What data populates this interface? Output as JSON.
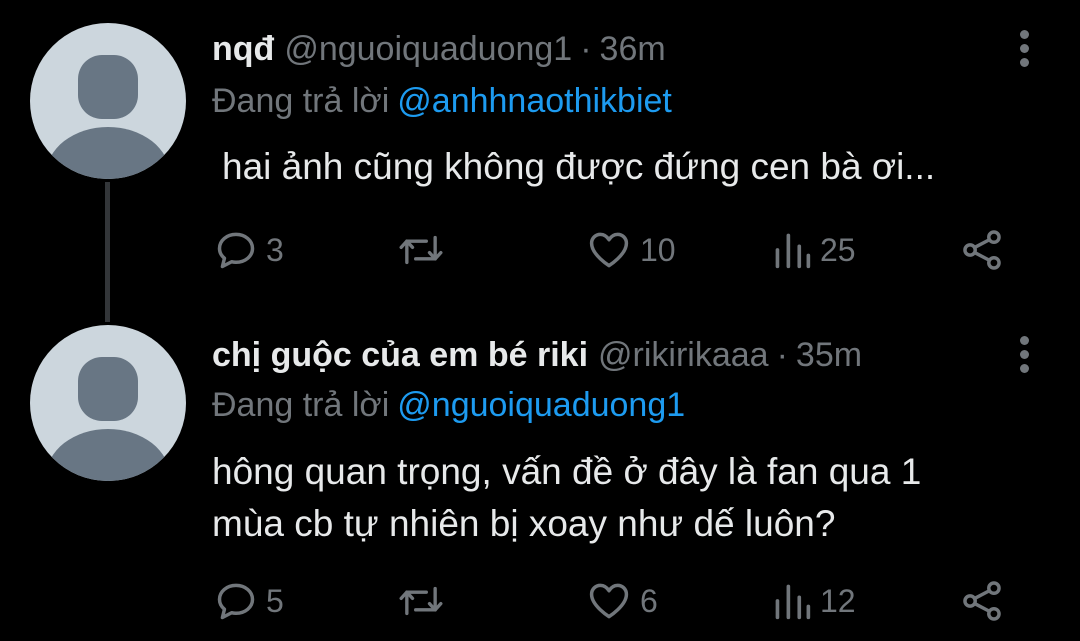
{
  "tweets": [
    {
      "name": "nqđ",
      "handle": "@nguoiquaduong1",
      "separator": "·",
      "time": "36m",
      "replying_prefix": "Đang trả lời",
      "replying_to": "@anhhnaothikbiet",
      "text": "hai ảnh cũng không được đứng cen bà ơi...",
      "replies": "3",
      "likes": "10",
      "views": "25"
    },
    {
      "name": "chị guộc của em bé riki",
      "handle": "@rikirikaaa",
      "separator": "·",
      "time": "35m",
      "replying_prefix": "Đang trả lời",
      "replying_to": "@nguoiquaduong1",
      "text_line1": "hông quan trọng, vấn đề ở đây là fan qua 1",
      "text_line2": "mùa cb tự nhiên bị xoay như dế luôn?",
      "replies": "5",
      "likes": "6",
      "views": "12"
    }
  ],
  "icons": {
    "reply": "speech-bubble",
    "retweet": "retweet-arrows",
    "like": "heart-outline",
    "views": "bar-chart",
    "share": "share-nodes",
    "more": "vertical-ellipsis"
  },
  "colors": {
    "background": "#000000",
    "text": "#e7e9ea",
    "muted": "#71767b",
    "accent": "#1d9bf0",
    "avatar_bg": "#ccd6dd",
    "avatar_fg": "#687684"
  }
}
